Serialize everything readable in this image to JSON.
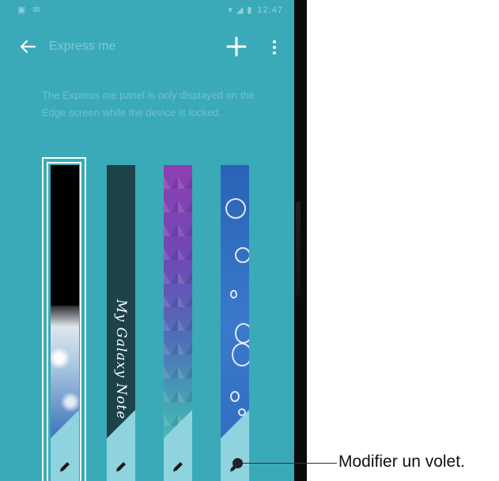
{
  "status_bar": {
    "left_icons": "▣ ✉",
    "right_icons": "▾ ◢ ▮",
    "time": "12:47"
  },
  "action_bar": {
    "title": "Express me"
  },
  "description": "The Express me panel is only displayed on the Edge screen while the device is locked.",
  "panels": [
    {
      "name": "panel-sky",
      "selected": true,
      "icon": "pencil-icon"
    },
    {
      "name": "panel-my-galaxy-note",
      "text": "My Galaxy Note",
      "icon": "pencil-icon"
    },
    {
      "name": "panel-triangles",
      "icon": "pencil-icon"
    },
    {
      "name": "panel-bubbles",
      "icon": "pencil-icon"
    }
  ],
  "callout": "Modifier un volet.",
  "colors": {
    "background": "#3aaab8",
    "corner": "#8fd3df"
  }
}
